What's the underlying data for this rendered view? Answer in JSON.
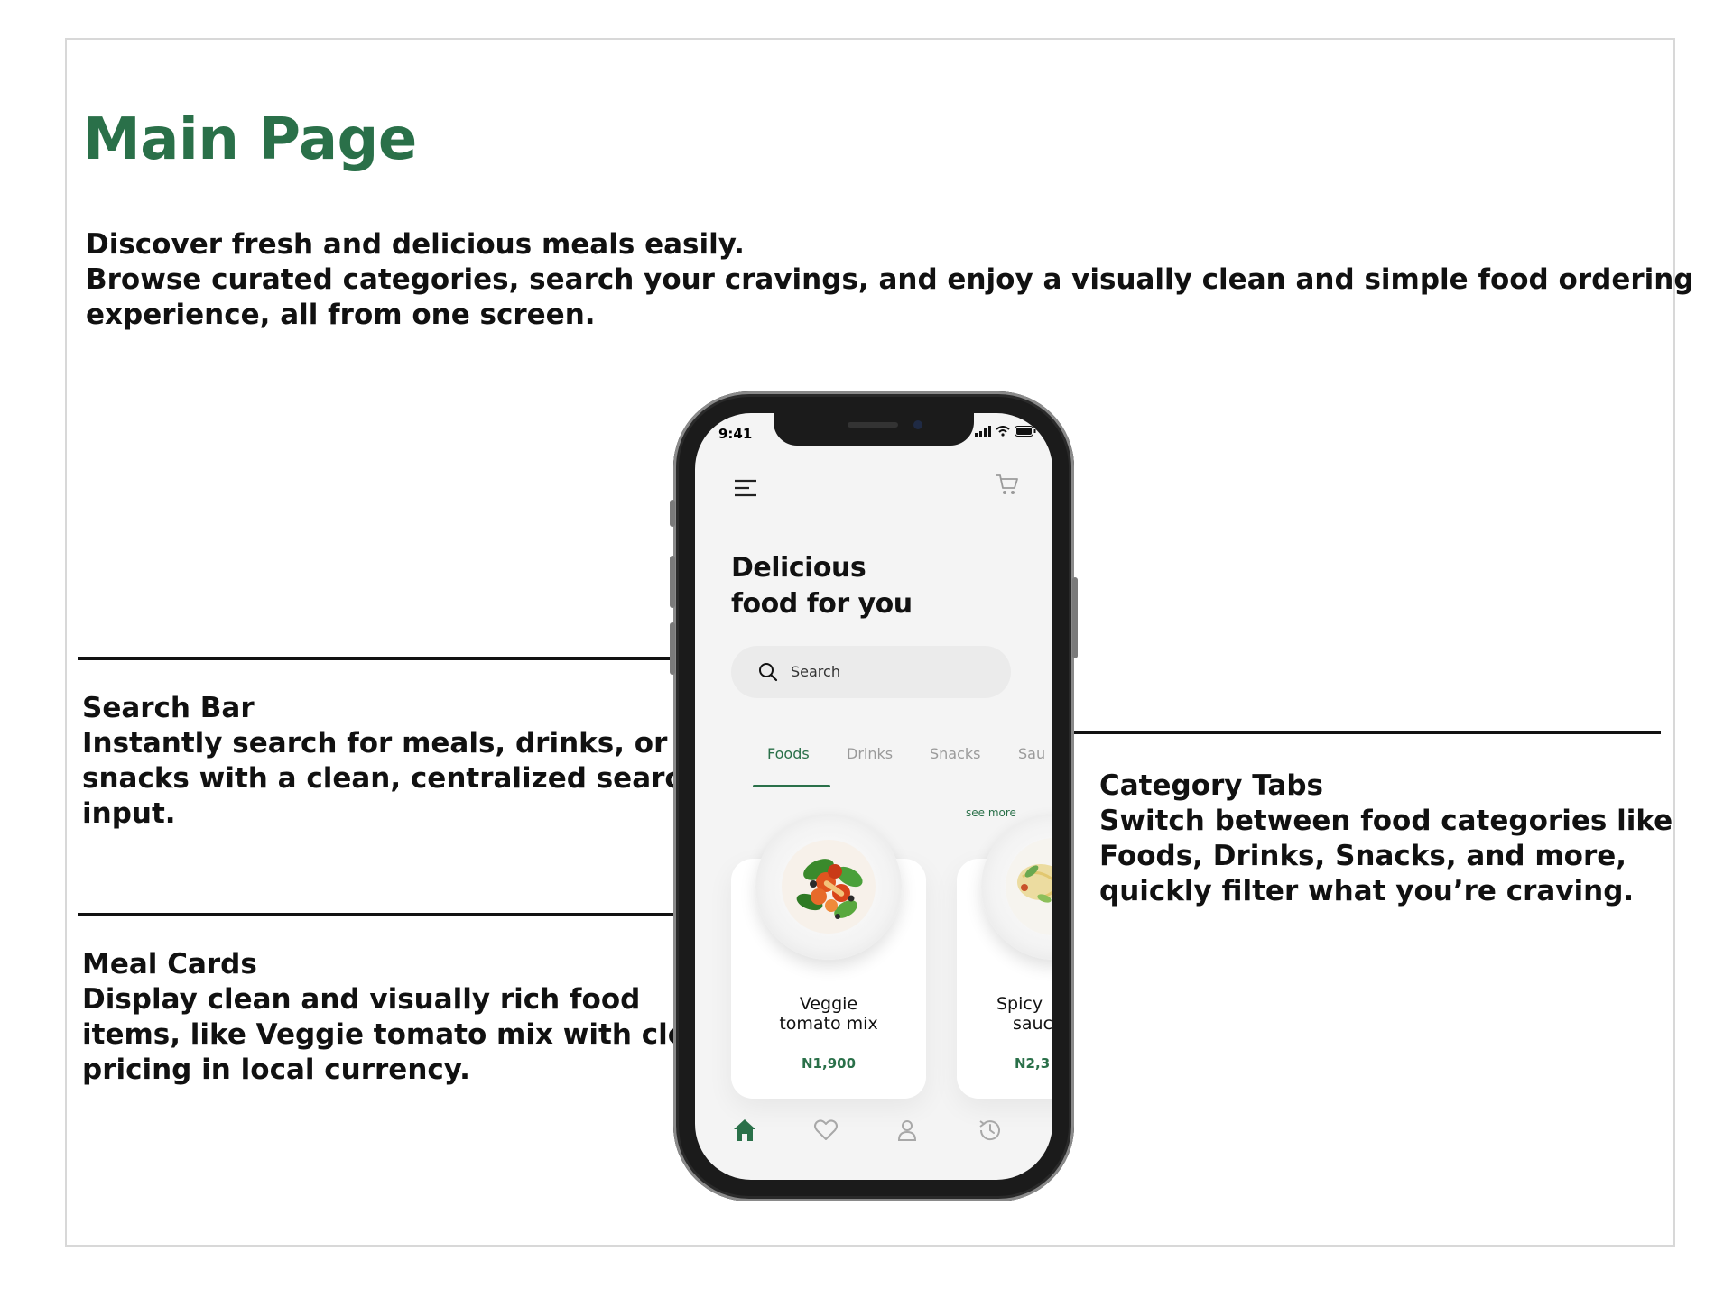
{
  "page": {
    "title": "Main Page",
    "intro_lines": [
      "Discover fresh and delicious meals easily.",
      "Browse curated categories, search your cravings, and enjoy a visually clean and simple food ordering",
      "experience, all from one screen."
    ],
    "accent_color": "#2a7049"
  },
  "annotations": {
    "search_bar": {
      "title": "Search Bar",
      "lines": [
        "Instantly search for meals, drinks, or",
        "snacks with a clean, centralized search",
        "input."
      ]
    },
    "meal_cards": {
      "title": "Meal Cards",
      "lines": [
        "Display clean and visually rich food",
        "items, like Veggie tomato mix with clear",
        "pricing in local currency."
      ]
    },
    "category_tabs": {
      "title": "Category Tabs",
      "lines": [
        "Switch between food categories like",
        "Foods, Drinks, Snacks, and more,",
        "quickly filter what you’re craving."
      ]
    }
  },
  "phone": {
    "status_time": "9:41",
    "headline_lines": [
      "Delicious",
      "food for you"
    ],
    "search_placeholder": "Search",
    "tabs": [
      "Foods",
      "Drinks",
      "Snacks",
      "Sau"
    ],
    "active_tab": "Foods",
    "see_more": "see more",
    "cards": [
      {
        "name_lines": [
          "Veggie",
          "tomato mix"
        ],
        "price": "N1,900"
      },
      {
        "name_lines": [
          "Spicy",
          "sauc"
        ],
        "price": "N2,3"
      }
    ],
    "nav_icons": [
      "home-icon",
      "heart-icon",
      "user-icon",
      "history-icon"
    ],
    "active_nav": "home-icon"
  }
}
